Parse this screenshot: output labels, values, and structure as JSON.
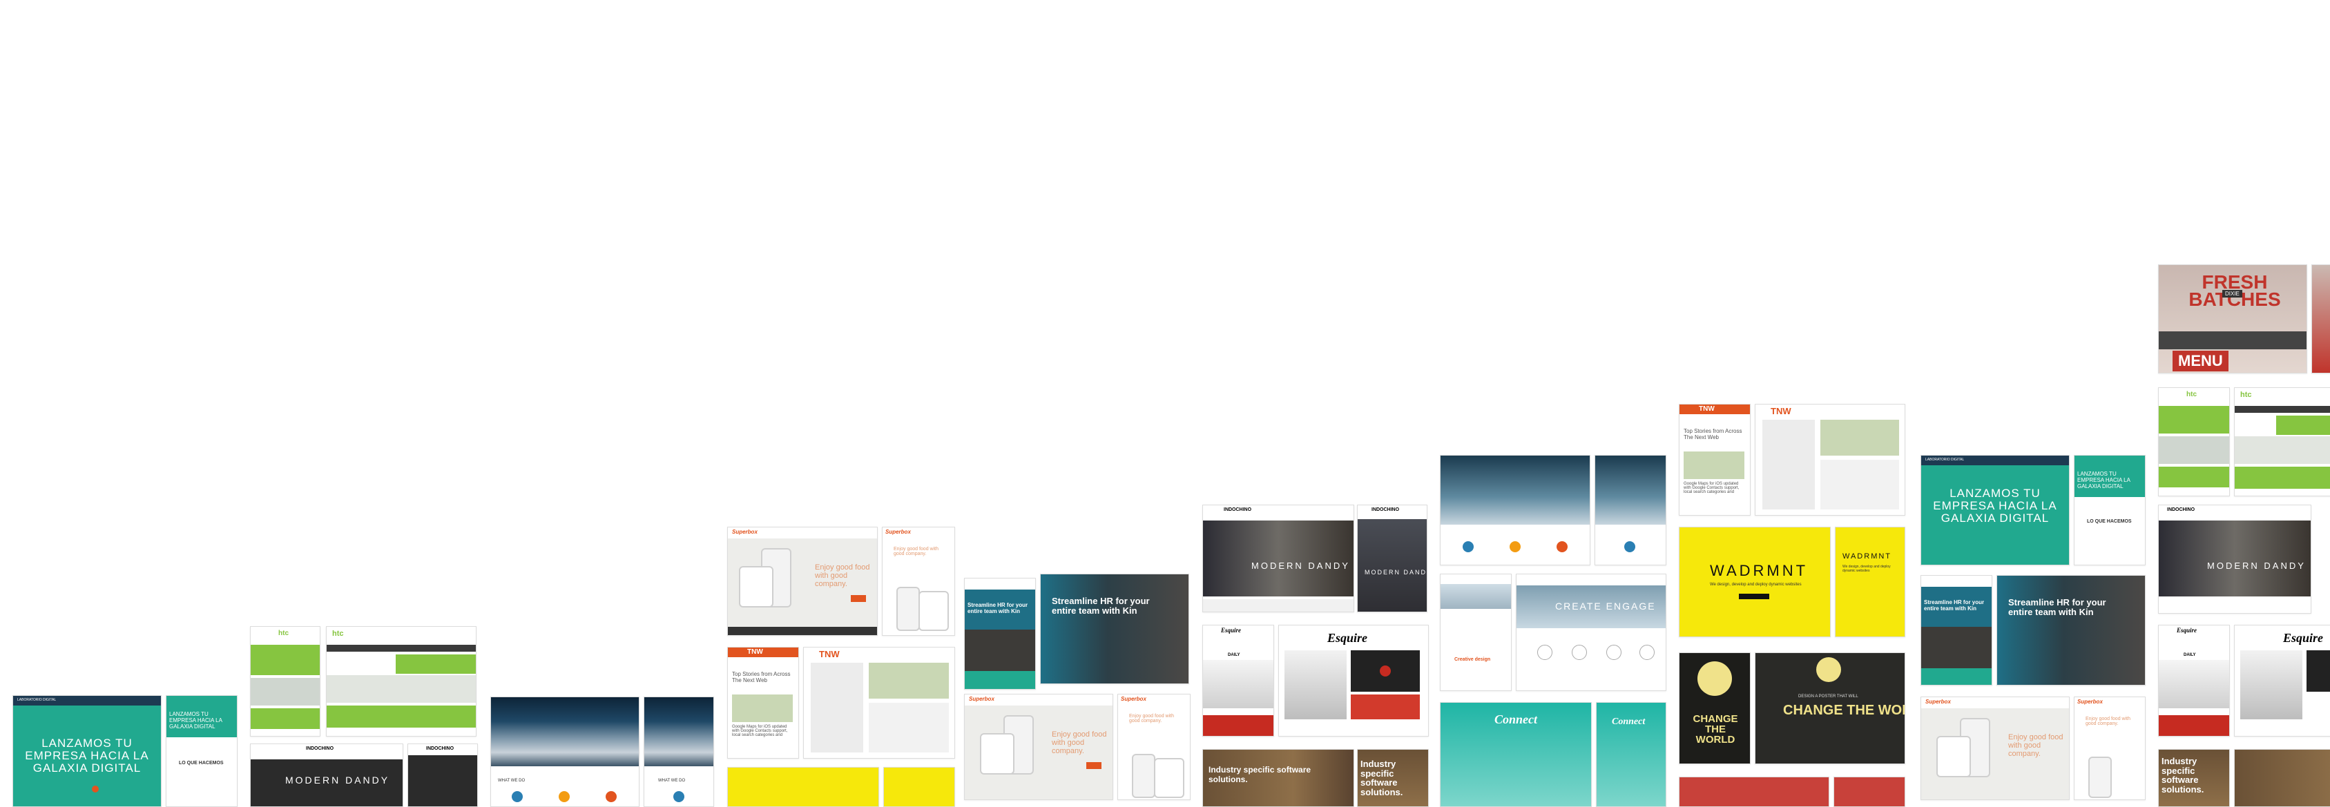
{
  "collage": {
    "laboratorio": {
      "logo": "LABORATORIO DIGITAL",
      "headline": "LANZAMOS TU EMPRESA HACIA LA GALAXIA DIGITAL",
      "section": "LO QUE HACEMOS"
    },
    "htc": {
      "logo": "htc"
    },
    "indochino": {
      "logo": "INDOCHINO",
      "hero": "MODERN DANDY"
    },
    "sky_site": {
      "label": "WHAT WE DO"
    },
    "superbox": {
      "logo": "Superbox",
      "tagline": "Enjoy good food with good company."
    },
    "tnw": {
      "logo": "TNW",
      "headline": "Top Stories from Across The Next Web",
      "body": "Google Maps for iOS updated with Google Contacts support, local search categories and"
    },
    "kin": {
      "headline": "Streamline HR for your entire team with Kin"
    },
    "esquire": {
      "logo": "Esquire",
      "section": "DAILY"
    },
    "industry": {
      "headline": "Industry specific software solutions."
    },
    "create_engage": {
      "headline": "CREATE ENGAGE",
      "caption": "Creative design"
    },
    "wadramt": {
      "logo": "WADRMNT",
      "sub": "We design, develop and deploy dynamic websites"
    },
    "change": {
      "headline": "CHANGE THE WORLD",
      "sub": "DESIGN A POSTER THAT WILL"
    },
    "fresh": {
      "headline": "FRESH BATCHES",
      "badge": "DIXIE",
      "menu": "MENU"
    },
    "connect": {
      "logo": "Connect"
    }
  },
  "colors": {
    "teal": "#21a98f",
    "orange": "#e2541f",
    "yellow": "#f6e80b",
    "green": "#86c540",
    "navy": "#1d3a52"
  }
}
